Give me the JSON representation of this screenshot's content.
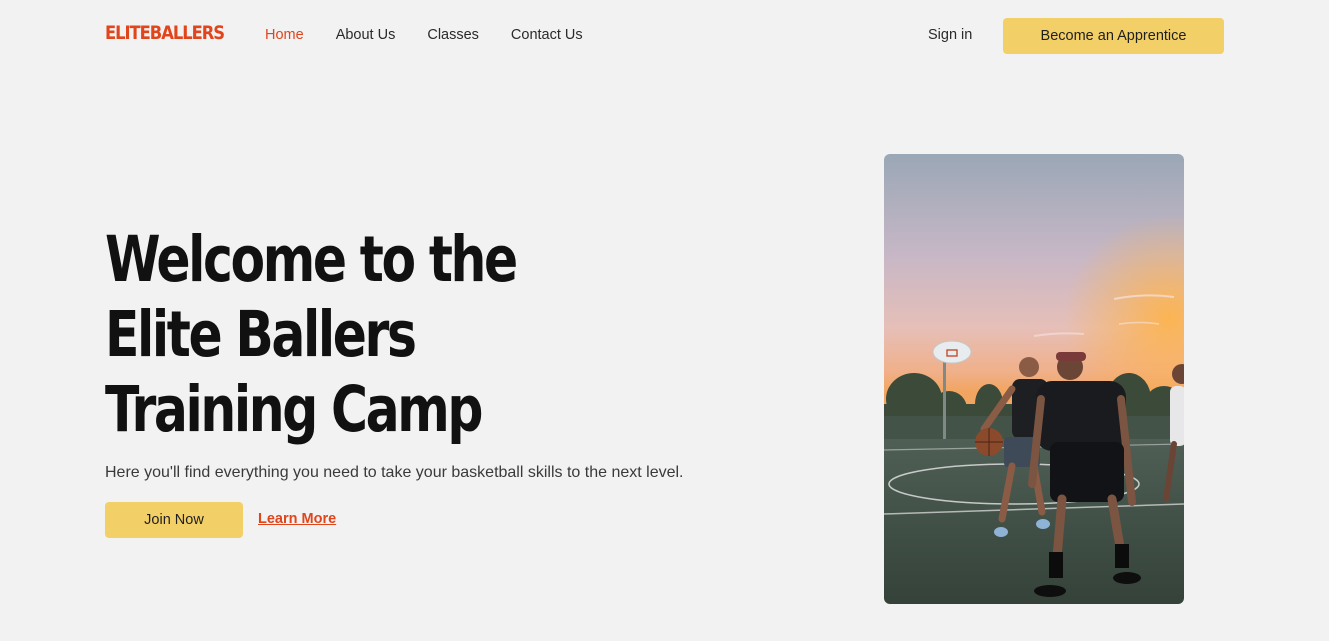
{
  "brand": {
    "logo": "ELITEBALLERS"
  },
  "nav": {
    "items": [
      {
        "label": "Home",
        "active": true
      },
      {
        "label": "About Us",
        "active": false
      },
      {
        "label": "Classes",
        "active": false
      },
      {
        "label": "Contact Us",
        "active": false
      }
    ]
  },
  "header": {
    "signin_label": "Sign in",
    "cta_label": "Become an Apprentice"
  },
  "hero": {
    "title_lines": [
      "Welcome to the",
      "Elite Ballers",
      "Training Camp"
    ],
    "subtitle": "Here you'll find everything you need to take your basketball skills to the next level.",
    "join_label": "Join Now",
    "learn_label": "Learn More"
  },
  "colors": {
    "background": "#f2f2f2",
    "accent": "#e0451b",
    "button": "#f3d067",
    "text": "#111111"
  }
}
